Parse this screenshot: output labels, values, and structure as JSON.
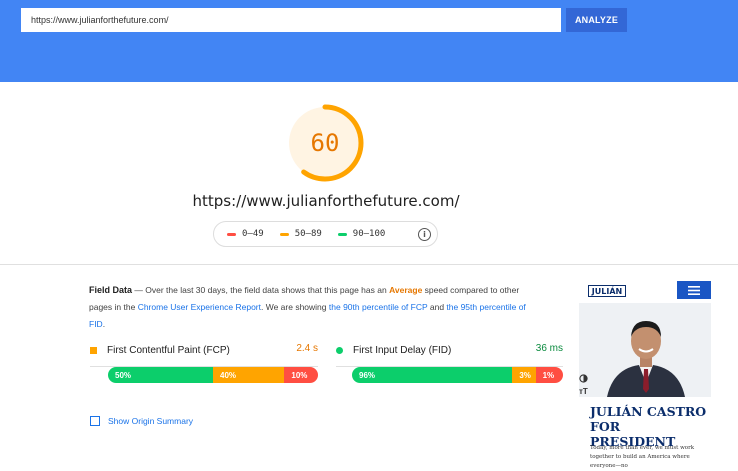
{
  "search": {
    "url_value": "https://www.julianforthefuture.com/",
    "analyze_label": "ANALYZE"
  },
  "score": {
    "value": "60",
    "fraction": 0.6,
    "color": "#ffa400",
    "text_color": "#e67700"
  },
  "page_url": "https://www.julianforthefuture.com/",
  "legend": {
    "items": [
      {
        "label": "0–49",
        "color": "#ff4e42"
      },
      {
        "label": "50–89",
        "color": "#ffa400"
      },
      {
        "label": "90–100",
        "color": "#0cce6b"
      }
    ],
    "info_icon": "info-icon"
  },
  "field_data": {
    "title": "Field Data",
    "desc_1": " — Over the last 30 days, the field data shows that this page has an ",
    "avg_label": "Average",
    "desc_2": " speed compared to other pages in the ",
    "report_link": "Chrome User Experience Report",
    "desc_3": ". We are showing ",
    "p90_link": "the 90th percentile of FCP",
    "desc_4": " and ",
    "p95_link": "the 95th percentile of FID",
    "desc_5": "."
  },
  "metrics": [
    {
      "name": "First Contentful Paint (FCP)",
      "value": "2.4 s",
      "value_color": "#e67700",
      "icon_color": "#ffa400",
      "segments": [
        {
          "label": "50%",
          "fraction": 0.5,
          "color": "#0cce6b"
        },
        {
          "label": "40%",
          "fraction": 0.34,
          "color": "#ffa400"
        },
        {
          "label": "10%",
          "fraction": 0.16,
          "color": "#ff4e42"
        }
      ]
    },
    {
      "name": "First Input Delay (FID)",
      "value": "36 ms",
      "value_color": "#0a8a3e",
      "icon_color": "#0cce6b",
      "segments": [
        {
          "label": "96%",
          "fraction": 0.76,
          "color": "#0cce6b"
        },
        {
          "label": "3%",
          "fraction": 0.11,
          "color": "#ffa400"
        },
        {
          "label": "1%",
          "fraction": 0.13,
          "color": "#ff4e42"
        }
      ]
    }
  ],
  "origin_summary": "Show Origin Summary",
  "thumbnail": {
    "logo_text": "JULIÁN",
    "headline": "JULIÁN CASTRO FOR PRESIDENT",
    "body": "Today, more than ever, we must work together to build an America where everyone—no"
  }
}
